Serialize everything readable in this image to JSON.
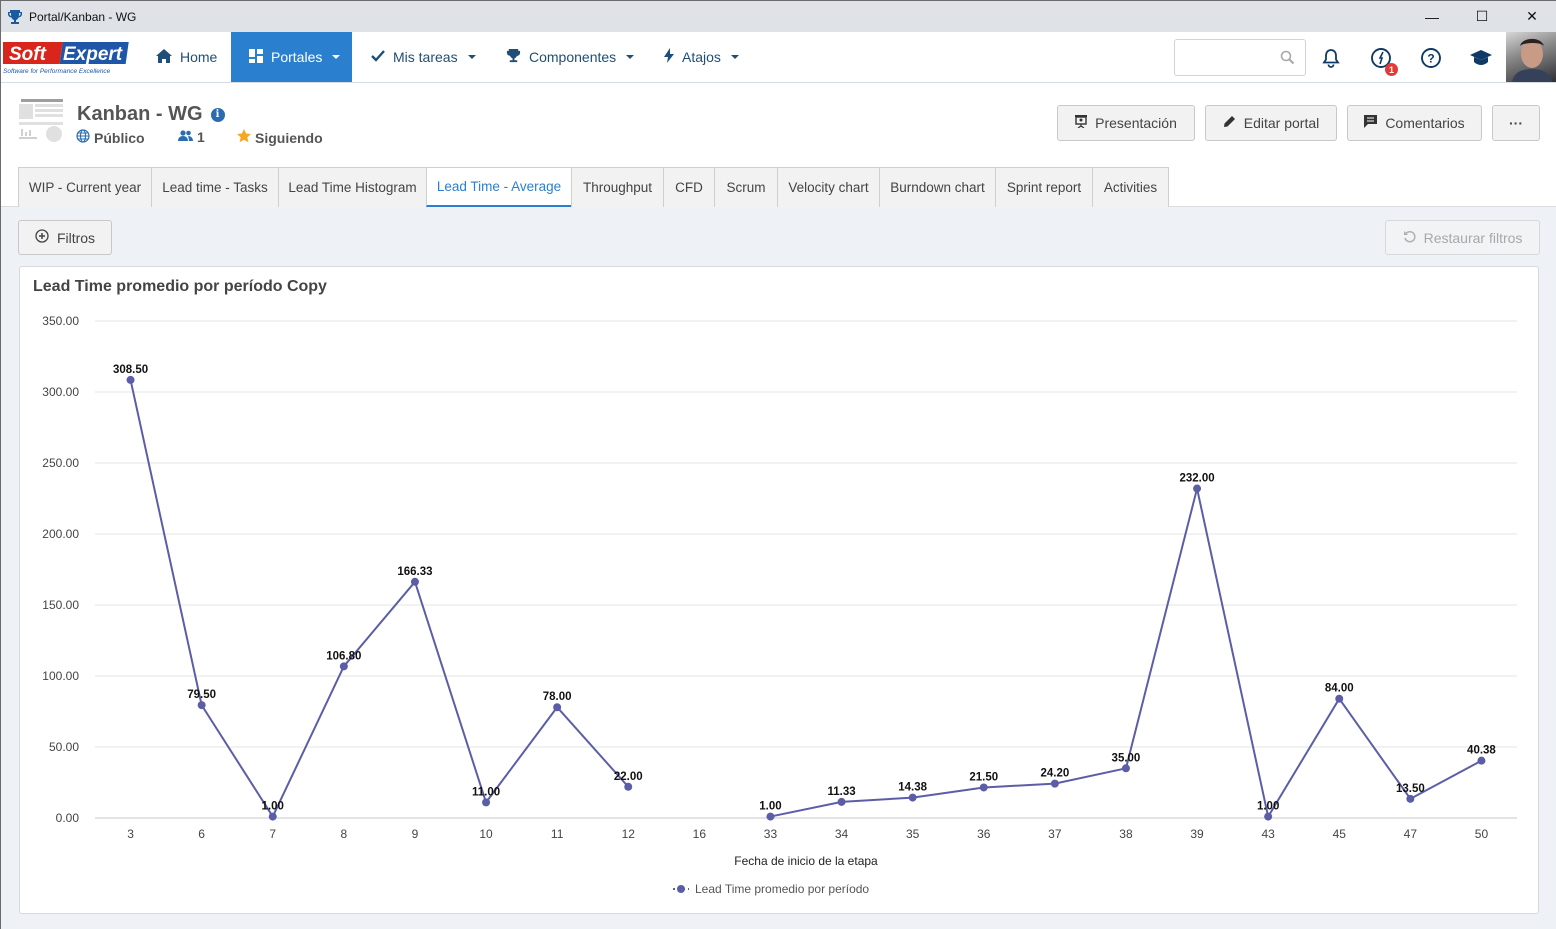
{
  "window": {
    "title": "Portal/Kanban - WG",
    "controls": [
      "minimize",
      "maximize",
      "close"
    ]
  },
  "navbar": {
    "logo_text": "Soft Expert",
    "logo_tagline": "Software for Performance Excellence",
    "items": [
      {
        "label": "Home",
        "icon": "home-icon",
        "active": false,
        "dropdown": false
      },
      {
        "label": "Portales",
        "icon": "portals-icon",
        "active": true,
        "dropdown": true
      },
      {
        "label": "Mis tareas",
        "icon": "check-icon",
        "active": false,
        "dropdown": true
      },
      {
        "label": "Componentes",
        "icon": "trophy-icon",
        "active": false,
        "dropdown": true
      },
      {
        "label": "Atajos",
        "icon": "bolt-icon",
        "active": false,
        "dropdown": true
      }
    ],
    "search_placeholder": "",
    "notifications_badge": "1",
    "accent_color": "#2b7fcf"
  },
  "portal": {
    "title": "Kanban - WG",
    "visibility": "Público",
    "members": "1",
    "following": "Siguiendo",
    "buttons": {
      "presentation": "Presentación",
      "edit": "Editar portal",
      "comments": "Comentarios",
      "more": "···"
    }
  },
  "tabs": [
    {
      "label": "WIP - Current year",
      "active": false
    },
    {
      "label": "Lead time - Tasks",
      "active": false
    },
    {
      "label": "Lead Time Histogram",
      "active": false
    },
    {
      "label": "Lead Time - Average",
      "active": true
    },
    {
      "label": "Throughput",
      "active": false
    },
    {
      "label": "CFD",
      "active": false
    },
    {
      "label": "Scrum",
      "active": false
    },
    {
      "label": "Velocity chart",
      "active": false
    },
    {
      "label": "Burndown chart",
      "active": false
    },
    {
      "label": "Sprint report",
      "active": false
    },
    {
      "label": "Activities",
      "active": false
    }
  ],
  "filters": {
    "filter_label": "Filtros",
    "restore_label": "Restaurar filtros"
  },
  "card": {
    "title": "Lead Time promedio por período Copy"
  },
  "chart_data": {
    "type": "line",
    "title": "Lead Time promedio por período Copy",
    "xlabel": "Fecha de inicio de la etapa",
    "ylabel": "",
    "categories": [
      "3",
      "6",
      "7",
      "8",
      "9",
      "10",
      "11",
      "12",
      "16",
      "33",
      "34",
      "35",
      "36",
      "37",
      "38",
      "39",
      "43",
      "45",
      "47",
      "50"
    ],
    "series": [
      {
        "name": "Lead Time promedio por período",
        "color": "#5b5ea6",
        "values": [
          308.5,
          79.5,
          1.0,
          106.8,
          166.33,
          11.0,
          78.0,
          22.0,
          null,
          1.0,
          11.33,
          14.38,
          21.5,
          24.2,
          35.0,
          232.0,
          1.0,
          84.0,
          13.5,
          40.38
        ],
        "labels": [
          "308.50",
          "79.50",
          "1.00",
          "106.80",
          "166.33",
          "11.00",
          "78.00",
          "22.00",
          null,
          "1.00",
          "11.33",
          "14.38",
          "21.50",
          "24.20",
          "35.00",
          "232.00",
          "1.00",
          "84.00",
          "13.50",
          "40.38"
        ]
      }
    ],
    "yticks": [
      "0.00",
      "50.00",
      "100.00",
      "150.00",
      "200.00",
      "250.00",
      "300.00",
      "350.00"
    ],
    "ylim": [
      0,
      350
    ],
    "grid": true,
    "legend": "bottom-center"
  }
}
